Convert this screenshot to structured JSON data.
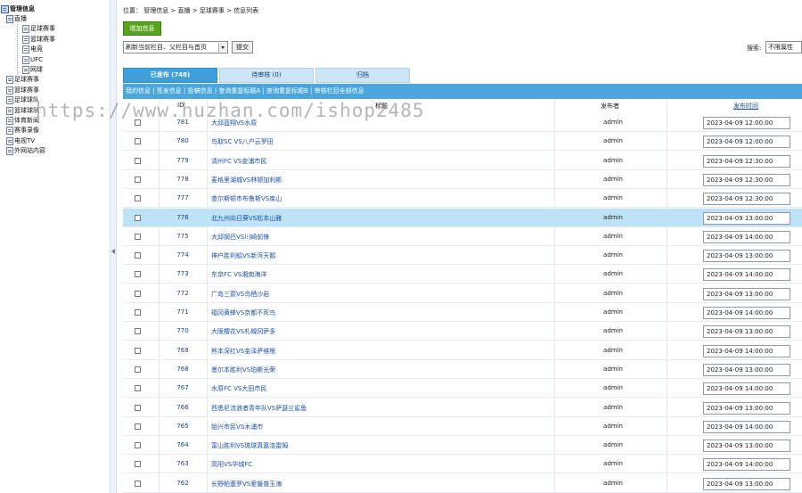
{
  "tree": {
    "root_label": "管理信息",
    "items": [
      {
        "label": "直播",
        "level": 1,
        "type": "folder"
      },
      {
        "label": "足球赛事",
        "level": 2,
        "type": "doc"
      },
      {
        "label": "篮球赛事",
        "level": 2,
        "type": "doc"
      },
      {
        "label": "电竞",
        "level": 2,
        "type": "doc"
      },
      {
        "label": "UFC",
        "level": 2,
        "type": "doc"
      },
      {
        "label": "网球",
        "level": 2,
        "type": "doc"
      },
      {
        "label": "足球赛事",
        "level": 1,
        "type": "doc"
      },
      {
        "label": "篮球赛事",
        "level": 1,
        "type": "doc"
      },
      {
        "label": "足球球队",
        "level": 1,
        "type": "doc"
      },
      {
        "label": "篮球球队",
        "level": 1,
        "type": "doc"
      },
      {
        "label": "体育新闻",
        "level": 1,
        "type": "doc"
      },
      {
        "label": "赛事录像",
        "level": 1,
        "type": "doc"
      },
      {
        "label": "电视TV",
        "level": 1,
        "type": "doc"
      },
      {
        "label": "外网站内容",
        "level": 1,
        "type": "doc"
      }
    ]
  },
  "breadcrumb": "位置： 管理信息 > 直播 > 足球赛事 > 信息列表",
  "toolbar": {
    "add_label": "增加信息",
    "category_select": "刷新当前栏目、父栏目与首页",
    "submit_label": "提交",
    "search_label": "搜索:",
    "attr_select": "不限属性"
  },
  "tabs": [
    {
      "label": "已发布 (748)",
      "active": true
    },
    {
      "label": "待审核 (0)",
      "active": false
    },
    {
      "label": "归档",
      "active": false
    }
  ],
  "linkbar": "我的信息 | 签发信息 | 投稿信息 | 查询重复标题A | 查询重复标题B | 审核栏目全部信息",
  "columns": {
    "id": "ID",
    "title": "标题",
    "publisher": "发布者",
    "time": "发布时间"
  },
  "watermark": "https://www.huzhan.com/ishop2485",
  "rows": [
    {
      "id": "781",
      "title": "大邱蓝翔VS水原",
      "publisher": "admin",
      "time": "2023-04-09 12:00:00"
    },
    {
      "id": "780",
      "title": "鸟取SC VS八户云罗田",
      "publisher": "admin",
      "time": "2023-04-09 12:00:00"
    },
    {
      "id": "779",
      "title": "清州FC VS金浦市民",
      "publisher": "admin",
      "time": "2023-04-09 12:30:00"
    },
    {
      "id": "778",
      "title": "麦格里湖城VS林顿加利斯",
      "publisher": "admin",
      "time": "2023-04-09 12:30:00"
    },
    {
      "id": "777",
      "title": "查尔斯顿市布鲁斯VS库山",
      "publisher": "admin",
      "time": "2023-04-09 12:30:00"
    },
    {
      "id": "776",
      "title": "北九州向日葵VS松本山雅",
      "publisher": "admin",
      "time": "2023-04-09 13:00:00"
    },
    {
      "id": "775",
      "title": "大邱钢巴VS川崎前锋",
      "publisher": "admin",
      "time": "2023-04-09 14:00:00"
    },
    {
      "id": "774",
      "title": "神户胜利船VS新泻天鹅",
      "publisher": "admin",
      "time": "2023-04-09 13:00:00"
    },
    {
      "id": "773",
      "title": "东京FC VS湘南海洋",
      "publisher": "admin",
      "time": "2023-04-09 14:00:00"
    },
    {
      "id": "772",
      "title": "广岛三箭VS鸟栖沙岩",
      "publisher": "admin",
      "time": "2023-04-09 13:00:00"
    },
    {
      "id": "771",
      "title": "福冈黄蜂VS京都不死鸟",
      "publisher": "admin",
      "time": "2023-04-09 14:00:00"
    },
    {
      "id": "770",
      "title": "大阪樱花VS札幌冈萨多",
      "publisher": "admin",
      "time": "2023-04-09 13:00:00"
    },
    {
      "id": "769",
      "title": "熊本深红VS金泽萨维根",
      "publisher": "admin",
      "time": "2023-04-09 14:00:00"
    },
    {
      "id": "768",
      "title": "墨尔本胜利VS珀斯光荣",
      "publisher": "admin",
      "time": "2023-04-09 13:00:00"
    },
    {
      "id": "767",
      "title": "水原FC VS大田市民",
      "publisher": "admin",
      "time": "2023-04-09 14:00:00"
    },
    {
      "id": "766",
      "title": "西悉尼流浪者青年队VS萨瑟兰鲨鱼",
      "publisher": "admin",
      "time": "2023-04-09 13:00:00"
    },
    {
      "id": "765",
      "title": "始兴市民VS木浦市",
      "publisher": "admin",
      "time": "2023-04-09 14:00:00"
    },
    {
      "id": "764",
      "title": "富山胜利VS琉球真嘉洛雷姆",
      "publisher": "admin",
      "time": "2023-04-09 13:00:00"
    },
    {
      "id": "763",
      "title": "高阳VS华城FC",
      "publisher": "admin",
      "time": "2023-04-09 14:00:00"
    },
    {
      "id": "762",
      "title": "长野帕塞罗VS爱媛普玉海",
      "publisher": "admin",
      "time": "2023-04-09 13:00:00"
    }
  ],
  "highlighted_row_id": "776"
}
